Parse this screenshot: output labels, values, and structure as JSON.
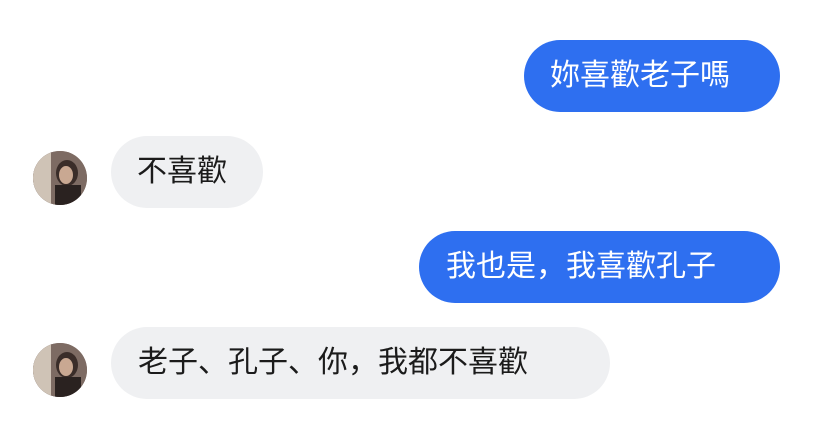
{
  "messages": [
    {
      "id": 1,
      "sender": "me",
      "text": "妳喜歡老子嗎"
    },
    {
      "id": 2,
      "sender": "them",
      "text": "不喜歡",
      "avatar": "profile-avatar-icon"
    },
    {
      "id": 3,
      "sender": "me",
      "text": "我也是，我喜歡孔子"
    },
    {
      "id": 4,
      "sender": "them",
      "text": "老子、孔子、你，我都不喜歡",
      "avatar": "profile-avatar-icon"
    }
  ],
  "colors": {
    "outgoing_bubble": "#2e6ff0",
    "incoming_bubble": "#eff0f2",
    "outgoing_text": "#ffffff",
    "incoming_text": "#1b1b1b",
    "background": "#ffffff"
  }
}
